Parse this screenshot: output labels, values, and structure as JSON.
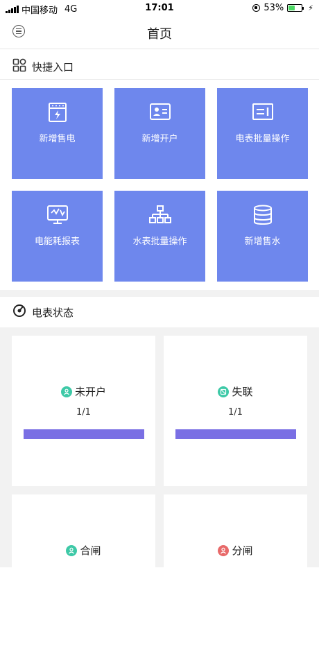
{
  "status_bar": {
    "carrier": "中国移动",
    "network": "4G",
    "time": "17:01",
    "battery_text": "53%",
    "battery_level": 0.53
  },
  "nav": {
    "title": "首页",
    "menu_icon": "menu-icon"
  },
  "quick_entry": {
    "title": "快捷入口",
    "icon": "grid-apps-icon",
    "tiles": [
      {
        "label": "新增售电",
        "icon": "electric-meter-icon"
      },
      {
        "label": "新增开户",
        "icon": "id-card-icon"
      },
      {
        "label": "电表批量操作",
        "icon": "meter-batch-icon"
      },
      {
        "label": "电能耗报表",
        "icon": "energy-report-icon"
      },
      {
        "label": "水表批量操作",
        "icon": "hierarchy-icon"
      },
      {
        "label": "新增售水",
        "icon": "database-icon"
      }
    ],
    "tile_color": "#6e87ed"
  },
  "meter_status": {
    "title": "电表状态",
    "icon": "gauge-icon",
    "cards": [
      {
        "title": "未开户",
        "count": "1/1",
        "progress": 1.0,
        "dot_color": "#3ec9a7",
        "icon": "user-icon"
      },
      {
        "title": "失联",
        "count": "1/1",
        "progress": 1.0,
        "dot_color": "#3ec9a7",
        "icon": "disconnect-icon"
      },
      {
        "title": "合闸",
        "count": "",
        "progress": null,
        "dot_color": "#3ec9a7",
        "icon": "user-icon"
      },
      {
        "title": "分闸",
        "count": "",
        "progress": null,
        "dot_color": "#e86a6a",
        "icon": "user-icon"
      }
    ],
    "bar_color": "#7a6fe4"
  }
}
